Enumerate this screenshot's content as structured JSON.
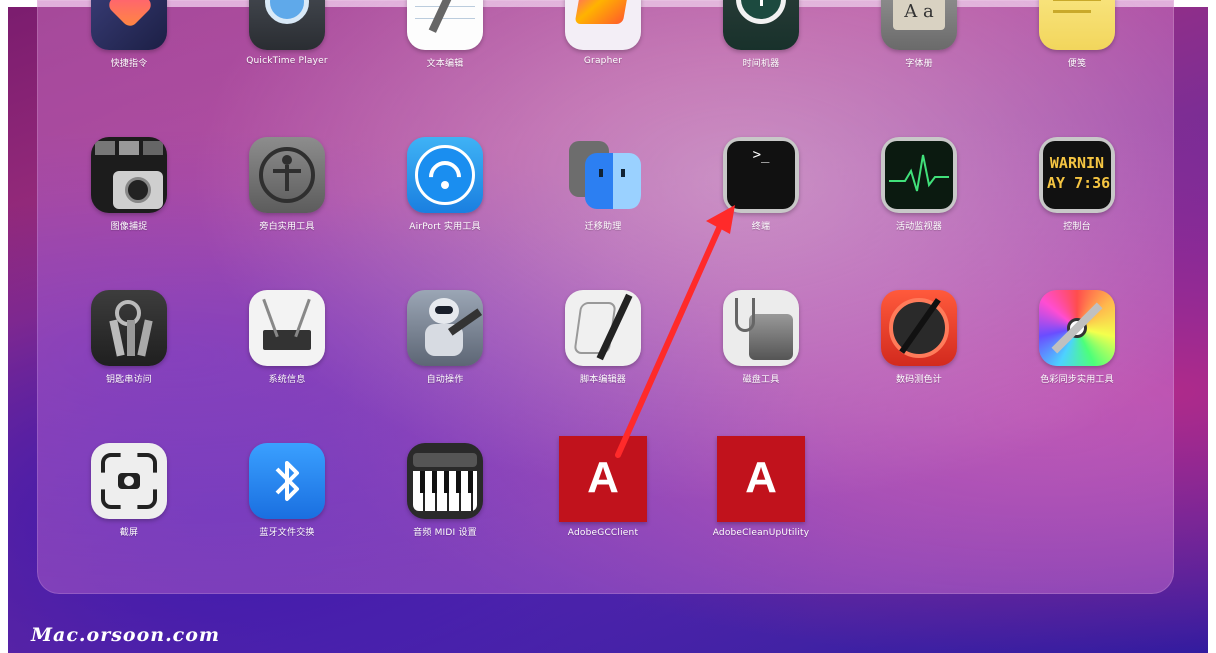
{
  "launchpad": {
    "rows": [
      [
        {
          "label": "快捷指令",
          "icon": "shortcuts-icon"
        },
        {
          "label": "QuickTime Player",
          "icon": "quicktime-icon"
        },
        {
          "label": "文本编辑",
          "icon": "textedit-icon"
        },
        {
          "label": "Grapher",
          "icon": "grapher-icon"
        },
        {
          "label": "时间机器",
          "icon": "time-machine-icon"
        },
        {
          "label": "字体册",
          "icon": "font-book-icon"
        },
        {
          "label": "便笺",
          "icon": "stickies-icon"
        }
      ],
      [
        {
          "label": "图像捕捉",
          "icon": "image-capture-icon"
        },
        {
          "label": "旁白实用工具",
          "icon": "voiceover-icon"
        },
        {
          "label": "AirPort 实用工具",
          "icon": "airport-icon"
        },
        {
          "label": "迁移助理",
          "icon": "migration-icon"
        },
        {
          "label": "终端",
          "icon": "terminal-icon"
        },
        {
          "label": "活动监视器",
          "icon": "activity-monitor-icon"
        },
        {
          "label": "控制台",
          "icon": "console-icon"
        }
      ],
      [
        {
          "label": "钥匙串访问",
          "icon": "keychain-icon"
        },
        {
          "label": "系统信息",
          "icon": "system-info-icon"
        },
        {
          "label": "自动操作",
          "icon": "automator-icon"
        },
        {
          "label": "脚本编辑器",
          "icon": "script-editor-icon"
        },
        {
          "label": "磁盘工具",
          "icon": "disk-utility-icon"
        },
        {
          "label": "数码测色计",
          "icon": "color-meter-icon"
        },
        {
          "label": "色彩同步实用工具",
          "icon": "colorsync-icon"
        }
      ],
      [
        {
          "label": "截屏",
          "icon": "screenshot-icon"
        },
        {
          "label": "蓝牙文件交换",
          "icon": "bluetooth-icon"
        },
        {
          "label": "音频 MIDI 设置",
          "icon": "audio-midi-icon"
        },
        {
          "label": "AdobeGCClient",
          "icon": "adobe-icon"
        },
        {
          "label": "AdobeCleanUpUtility",
          "icon": "adobe-icon"
        }
      ]
    ],
    "terminal_prompt": ">_",
    "console_text": [
      "WARNIN",
      "AY 7:36"
    ],
    "font_book_text": [
      "A A",
      "A a"
    ],
    "adobe_glyph": "A",
    "airport_wifi": "◉",
    "bluetooth_glyph": "✱"
  },
  "watermark": "Mac.orsoon.com",
  "colors": {
    "arrow": "#ff2a2a",
    "adobe": "#c1121c"
  }
}
